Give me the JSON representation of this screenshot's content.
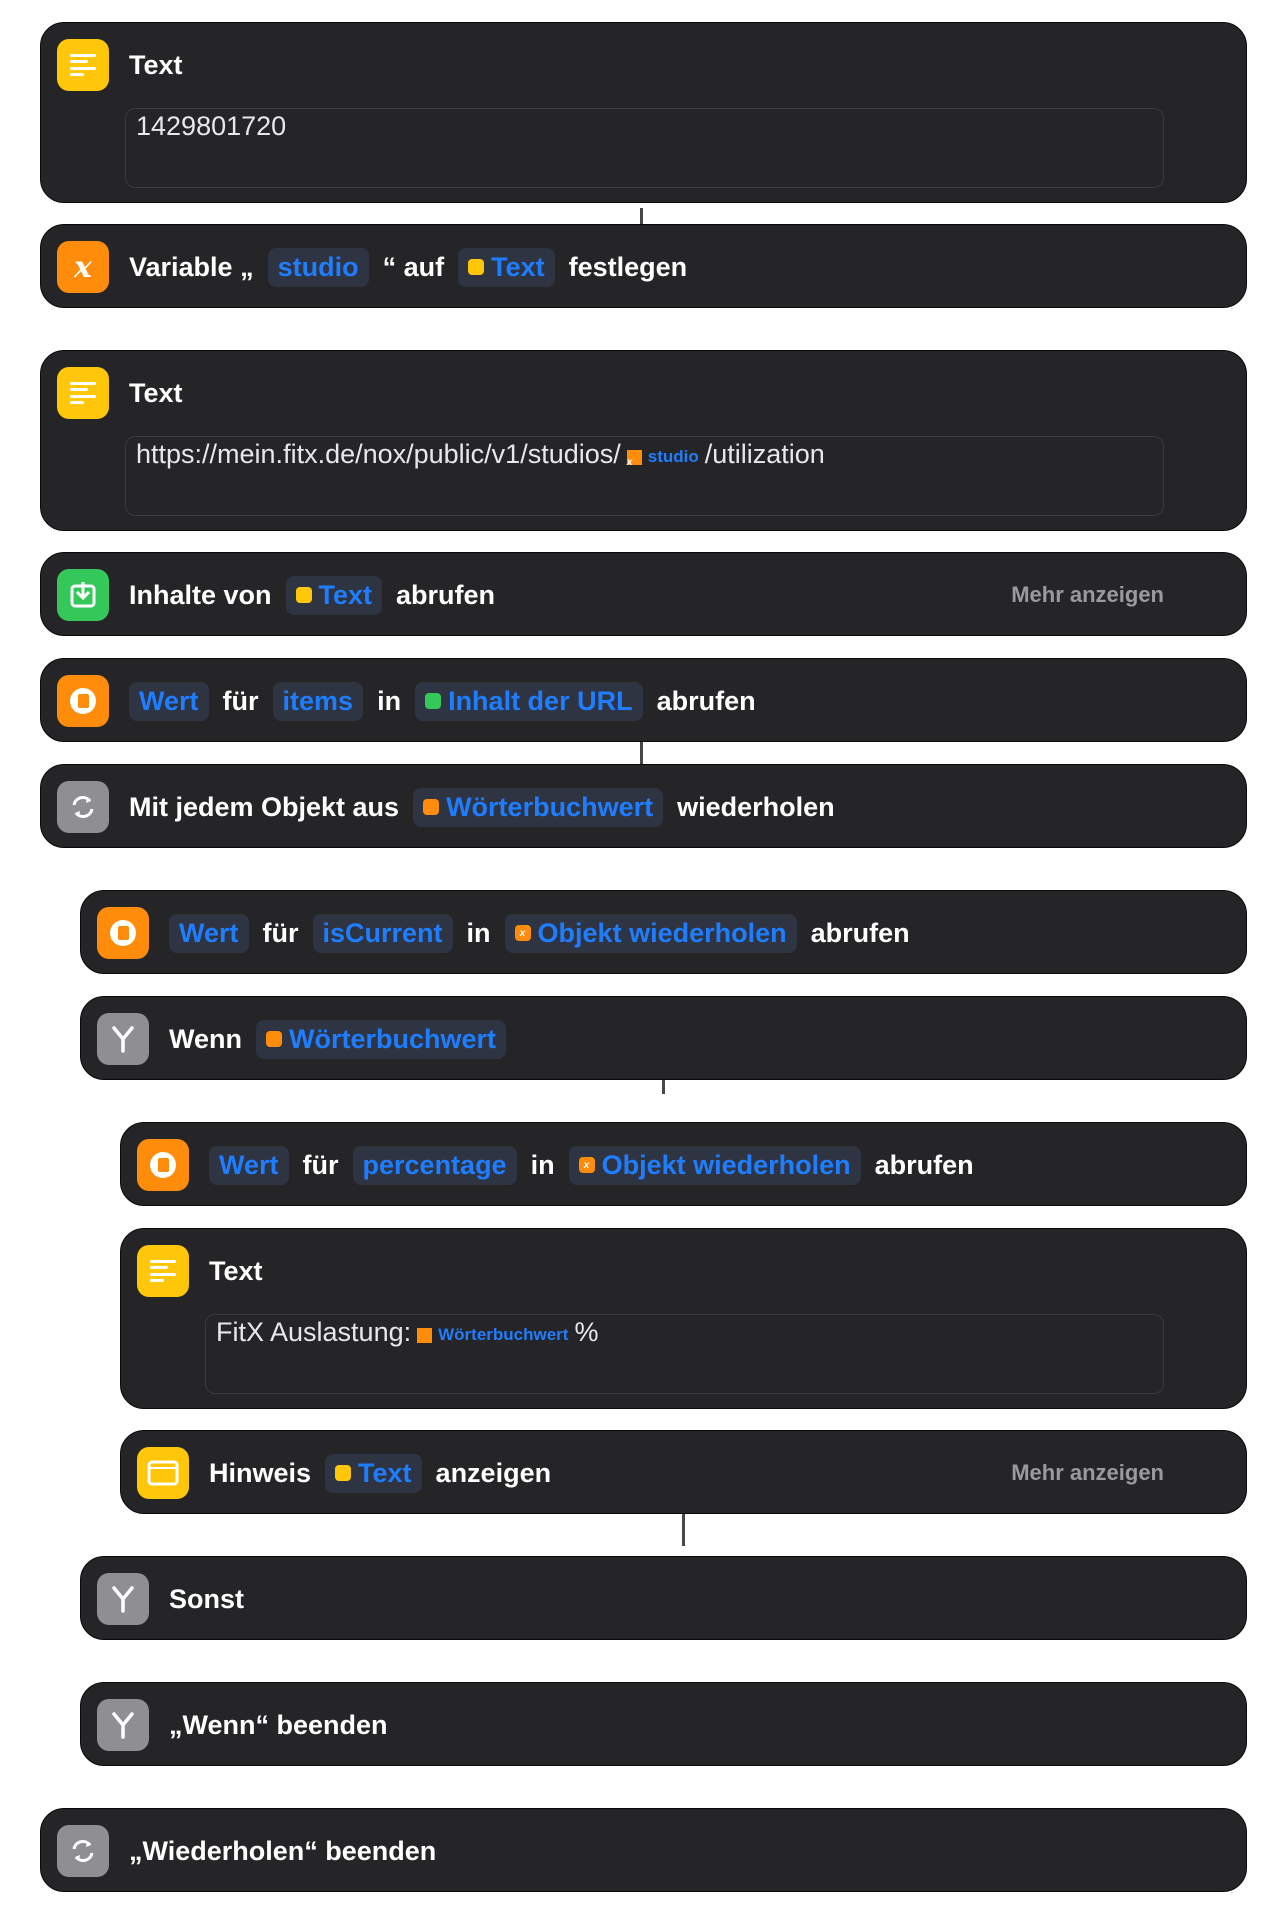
{
  "c1": {
    "title": "Text",
    "value": "1429801720"
  },
  "c2": {
    "w1": "Variable „",
    "t1": "studio",
    "w2": "“ auf",
    "t2": "Text",
    "w3": "festlegen"
  },
  "c3": {
    "title": "Text",
    "pre": "https://mein.fitx.de/nox/public/v1/studios/",
    "var": "studio",
    "post": "/utilization"
  },
  "c4": {
    "w1": "Inhalte von",
    "t1": "Text",
    "w2": "abrufen",
    "more": "Mehr anzeigen"
  },
  "c5": {
    "t1": "Wert",
    "w1": "für",
    "t2": "items",
    "w2": "in",
    "t3": "Inhalt der URL",
    "w3": "abrufen"
  },
  "c6": {
    "w1": "Mit jedem Objekt aus",
    "t1": "Wörterbuchwert",
    "w2": "wiederholen"
  },
  "c7": {
    "t1": "Wert",
    "w1": "für",
    "t2": "isCurrent",
    "w2": "in",
    "t3": "Objekt wiederholen",
    "w3": "abrufen"
  },
  "c8": {
    "w1": "Wenn",
    "t1": "Wörterbuchwert"
  },
  "c9": {
    "t1": "Wert",
    "w1": "für",
    "t2": "percentage",
    "w2": "in",
    "t3": "Objekt wiederholen",
    "w3": "abrufen"
  },
  "c10": {
    "title": "Text",
    "pre": "FitX Auslastung:",
    "var": "Wörterbuchwert",
    "post": "%"
  },
  "c11": {
    "w1": "Hinweis",
    "t1": "Text",
    "w2": "anzeigen",
    "more": "Mehr anzeigen"
  },
  "c12": {
    "w1": "Sonst"
  },
  "c13": {
    "w1": "„Wenn“ beenden"
  },
  "c14": {
    "w1": "„Wiederholen“ beenden"
  },
  "colors": {
    "card": "#252527",
    "token": "#1f7dff",
    "yellow": "#ffc60a",
    "orange": "#ff8c0a",
    "green": "#34c759",
    "gray": "#8e8e93"
  }
}
